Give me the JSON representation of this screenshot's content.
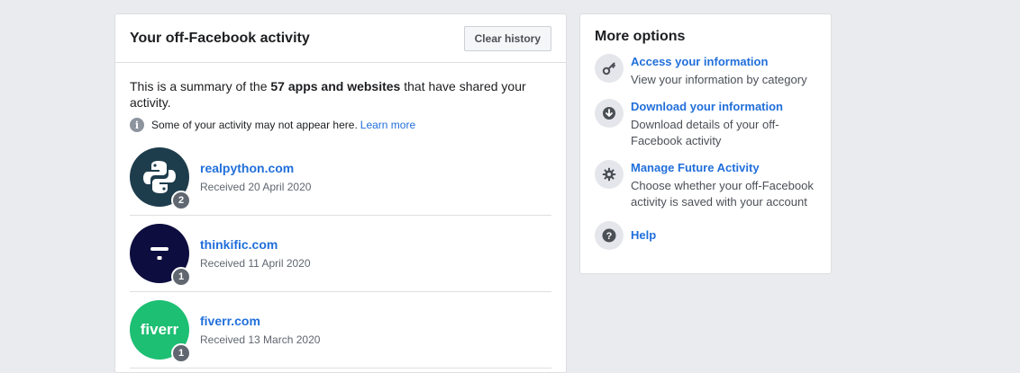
{
  "activity": {
    "title": "Your off-Facebook activity",
    "clear_label": "Clear history",
    "summary_pre": "This is a summary of the ",
    "summary_bold": "57 apps and websites",
    "summary_post": " that have shared your activity.",
    "notice_text": "Some of your activity may not appear here.",
    "learn_more": "Learn more",
    "apps": [
      {
        "name": "realpython.com",
        "date": "Received 20 April 2020",
        "count": "2",
        "logo": "python-logo-icon",
        "color": "#1e3d4c"
      },
      {
        "name": "thinkific.com",
        "date": "Received 11 April 2020",
        "count": "1",
        "logo": "thinkific-logo-icon",
        "color": "#0e0d3f"
      },
      {
        "name": "fiverr.com",
        "date": "Received 13 March 2020",
        "count": "1",
        "logo": "fiverr-logo-icon",
        "logo_text": "fiverr",
        "color": "#1dbf73"
      }
    ]
  },
  "options": {
    "title": "More options",
    "items": [
      {
        "title": "Access your information",
        "desc": "View your information by category",
        "icon": "key-icon"
      },
      {
        "title": "Download your information",
        "desc": "Download details of your off-Facebook activity",
        "icon": "download-icon"
      },
      {
        "title": "Manage Future Activity",
        "desc": "Choose whether your off-Facebook activity is saved with your account",
        "icon": "gear-icon"
      },
      {
        "title": "Help",
        "desc": "",
        "icon": "help-icon"
      }
    ]
  },
  "colors": {
    "link": "#216fdb",
    "background": "#e9ebee",
    "badge": "#606770"
  }
}
